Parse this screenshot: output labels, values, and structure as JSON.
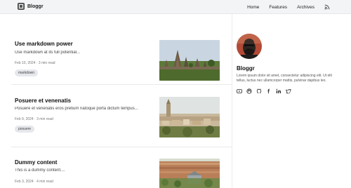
{
  "navbar": {
    "brand": "Bloggr",
    "links": [
      "Home",
      "Features",
      "Archives"
    ],
    "rss_icon": "rss-icon"
  },
  "posts": [
    {
      "title": "Use markdown power",
      "excerpt": "Use markdown at its full potential...",
      "meta": "Feb 10, 2024 · 3 min read",
      "tag": "markdown",
      "image": "temple-ruins-photo"
    },
    {
      "title": "Posuere et venenatis",
      "excerpt": "Posuere et venenatis eros pretium natoque porta dictum tempus...",
      "meta": "Feb 9, 2024 · 3 min read",
      "tag": "posuere",
      "image": "hillside-town-photo"
    },
    {
      "title": "Dummy content",
      "excerpt": "This is a dummy content....",
      "meta": "Feb 3, 2024 · 4 min read",
      "image": "city-aerial-photo"
    }
  ],
  "sidebar": {
    "title": "Bloggr",
    "description": "Lorem ipsum dolor sit amet, consectetur adipiscing elit. Ut elit tellus, luctus nec ullamcorper mattis, pulvinar dapibus leo.",
    "avatar": "avatar-photo",
    "social_icons": [
      "youtube-icon",
      "mastodon-icon",
      "github-icon",
      "facebook-icon",
      "linkedin-icon",
      "twitter-icon"
    ]
  }
}
